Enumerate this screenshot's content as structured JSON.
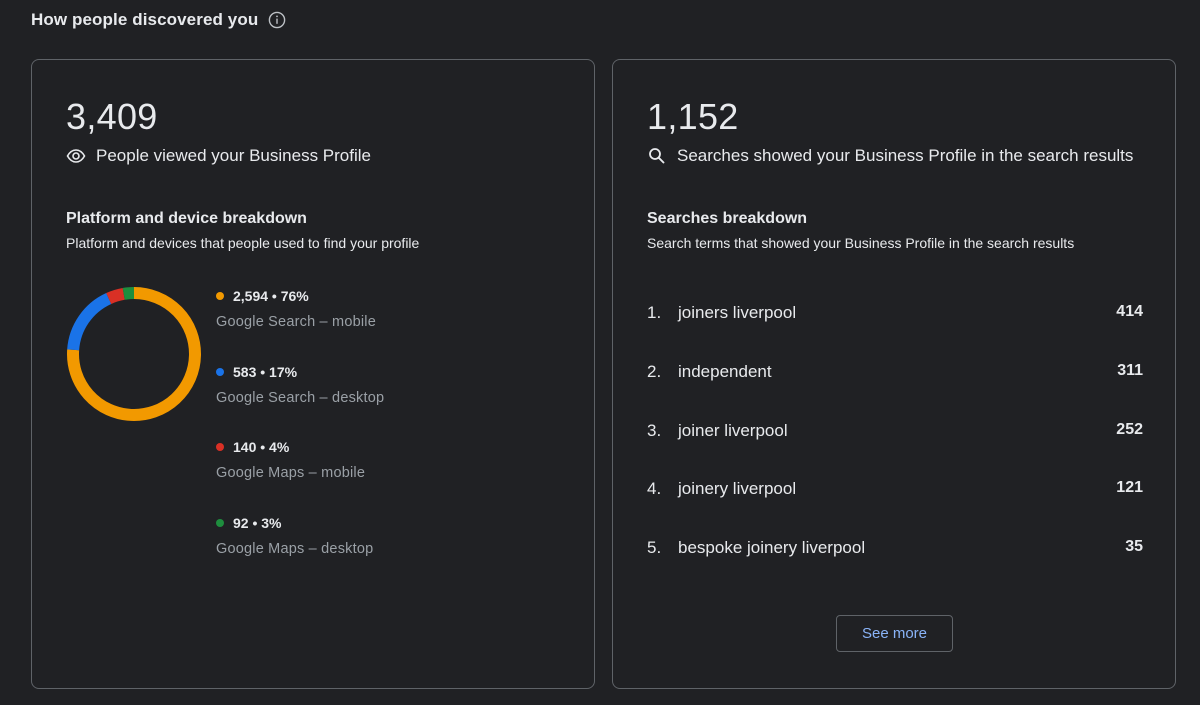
{
  "header": {
    "title": "How people discovered you",
    "info_icon": "info-icon"
  },
  "profile_views": {
    "total": "3,409",
    "icon": "eye-icon",
    "label": "People viewed your Business Profile",
    "breakdown_title": "Platform and device breakdown",
    "breakdown_subtitle": "Platform and devices that people used to find your profile",
    "items": [
      {
        "stat": "2,594 • 76%",
        "label": "Google Search – mobile",
        "color": "#f29900"
      },
      {
        "stat": "583 • 17%",
        "label": "Google Search – desktop",
        "color": "#1a73e8"
      },
      {
        "stat": "140 • 4%",
        "label": "Google Maps – mobile",
        "color": "#d93025"
      },
      {
        "stat": "92 • 3%",
        "label": "Google Maps – desktop",
        "color": "#1e8e3e"
      }
    ]
  },
  "chart_data": {
    "type": "pie",
    "categories": [
      "Google Search – mobile",
      "Google Search – desktop",
      "Google Maps – mobile",
      "Google Maps – desktop"
    ],
    "values": [
      2594,
      583,
      140,
      92
    ],
    "colors": [
      "#f29900",
      "#1a73e8",
      "#d93025",
      "#1e8e3e"
    ]
  },
  "searches": {
    "total": "1,152",
    "icon": "search-icon",
    "label": "Searches showed your Business Profile in the search results",
    "breakdown_title": "Searches breakdown",
    "breakdown_subtitle": "Search terms that showed your Business Profile in the search results",
    "terms": [
      {
        "index": "1.",
        "term": "joiners liverpool",
        "count": "414"
      },
      {
        "index": "2.",
        "term": "independent",
        "count": "311"
      },
      {
        "index": "3.",
        "term": "joiner liverpool",
        "count": "252"
      },
      {
        "index": "4.",
        "term": "joinery liverpool",
        "count": "121"
      },
      {
        "index": "5.",
        "term": "bespoke joinery liverpool",
        "count": "35"
      }
    ],
    "see_more_label": "See more"
  }
}
